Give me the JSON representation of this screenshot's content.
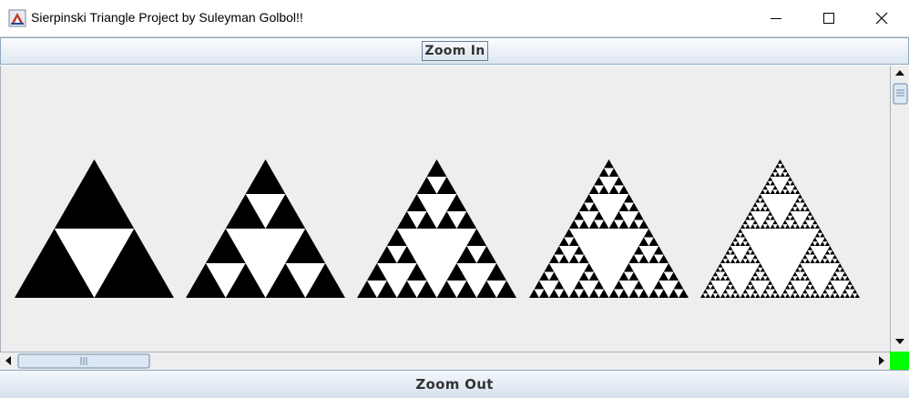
{
  "window": {
    "title": "Sierpinski Triangle Project by Suleyman Golbol!!",
    "app_icon": "java-cup-icon"
  },
  "toolbar": {
    "zoom_in_label": "Zoom In"
  },
  "canvas": {
    "triangles": [
      {
        "depth": 1
      },
      {
        "depth": 2
      },
      {
        "depth": 3
      },
      {
        "depth": 4
      },
      {
        "depth": 5
      }
    ],
    "fill_color": "#000000",
    "hole_color": "#ffffff",
    "background_color": "#eeeeee"
  },
  "footer": {
    "zoom_out_label": "Zoom Out"
  },
  "status": {
    "corner_color": "#00ff00"
  }
}
